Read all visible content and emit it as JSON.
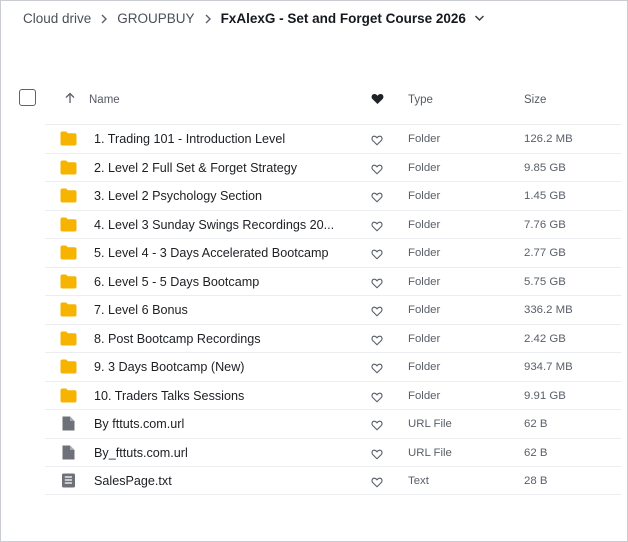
{
  "breadcrumb": {
    "items": [
      "Cloud drive",
      "GROUPBUY"
    ],
    "current": "FxAlexG - Set and Forget Course 2026"
  },
  "columns": {
    "name": "Name",
    "type": "Type",
    "size": "Size"
  },
  "colors": {
    "folder": "#f6b400",
    "file": "#6e7278",
    "accent": "#1f2328"
  },
  "rows": [
    {
      "icon": "folder-icon",
      "name": "1. Trading 101 - Introduction Level",
      "type": "Folder",
      "size": "126.2 MB"
    },
    {
      "icon": "folder-icon",
      "name": "2. Level 2 Full Set & Forget Strategy",
      "type": "Folder",
      "size": "9.85 GB"
    },
    {
      "icon": "folder-icon",
      "name": "3. Level 2 Psychology Section",
      "type": "Folder",
      "size": "1.45 GB"
    },
    {
      "icon": "folder-icon",
      "name": "4. Level 3 Sunday Swings Recordings 20...",
      "type": "Folder",
      "size": "7.76 GB"
    },
    {
      "icon": "folder-icon",
      "name": "5. Level 4 - 3 Days Accelerated Bootcamp",
      "type": "Folder",
      "size": "2.77 GB"
    },
    {
      "icon": "folder-icon",
      "name": "6. Level 5 - 5 Days Bootcamp",
      "type": "Folder",
      "size": "5.75 GB"
    },
    {
      "icon": "folder-icon",
      "name": "7. Level 6 Bonus",
      "type": "Folder",
      "size": "336.2 MB"
    },
    {
      "icon": "folder-icon",
      "name": "8. Post Bootcamp Recordings",
      "type": "Folder",
      "size": "2.42 GB"
    },
    {
      "icon": "folder-icon",
      "name": "9. 3 Days Bootcamp (New)",
      "type": "Folder",
      "size": "934.7 MB"
    },
    {
      "icon": "folder-icon",
      "name": "10. Traders Talks Sessions",
      "type": "Folder",
      "size": "9.91 GB"
    },
    {
      "icon": "file-icon",
      "name": "By fttuts.com.url",
      "type": "URL File",
      "size": "62 B"
    },
    {
      "icon": "file-icon",
      "name": "By_fttuts.com.url",
      "type": "URL File",
      "size": "62 B"
    },
    {
      "icon": "text-file-icon",
      "name": "SalesPage.txt",
      "type": "Text",
      "size": "28 B"
    }
  ]
}
